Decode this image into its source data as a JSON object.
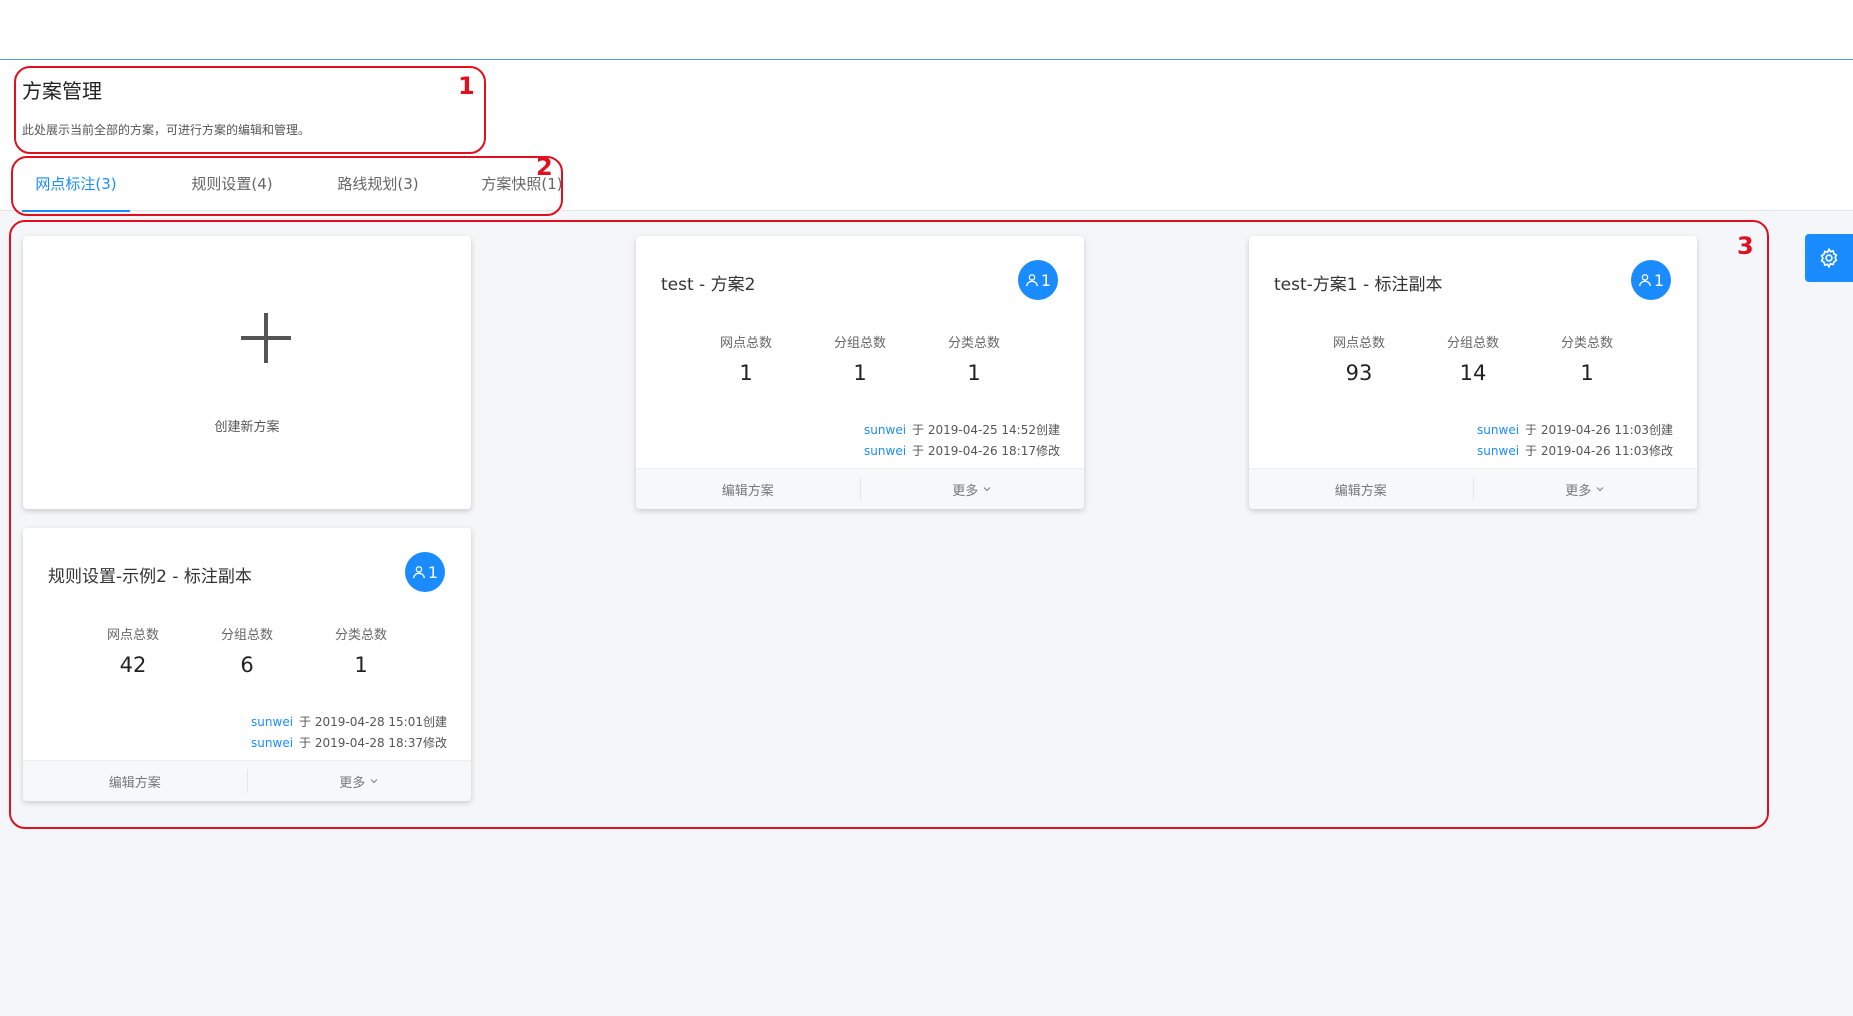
{
  "header": {
    "title": "方案管理",
    "description": "此处展示当前全部的方案，可进行方案的编辑和管理。"
  },
  "tabs": [
    {
      "label": "网点标注(3)",
      "active": true
    },
    {
      "label": "规则设置(4)",
      "active": false
    },
    {
      "label": "路线规划(3)",
      "active": false
    },
    {
      "label": "方案快照(1)",
      "active": false
    }
  ],
  "create_card": {
    "label": "创建新方案"
  },
  "stat_labels": {
    "points": "网点总数",
    "groups": "分组总数",
    "categories": "分类总数"
  },
  "plans": [
    {
      "title": "test - 方案2",
      "users": "1",
      "points": "1",
      "groups": "1",
      "categories": "1",
      "created_by": "sunwei",
      "created_text": "于  2019-04-25 14:52创建",
      "modified_by": "sunwei",
      "modified_text": "于  2019-04-26 18:17修改"
    },
    {
      "title": "test-方案1 - 标注副本",
      "users": "1",
      "points": "93",
      "groups": "14",
      "categories": "1",
      "created_by": "sunwei",
      "created_text": "于  2019-04-26 11:03创建",
      "modified_by": "sunwei",
      "modified_text": "于  2019-04-26 11:03修改"
    },
    {
      "title": "规则设置-示例2 - 标注副本",
      "users": "1",
      "points": "42",
      "groups": "6",
      "categories": "1",
      "created_by": "sunwei",
      "created_text": "于  2019-04-28 15:01创建",
      "modified_by": "sunwei",
      "modified_text": "于  2019-04-28 18:37修改"
    }
  ],
  "footer": {
    "edit_label": "编辑方案",
    "more_label": "更多"
  },
  "annotations": [
    "1",
    "2",
    "3"
  ],
  "colors": {
    "accent": "#1a8cff",
    "annotation": "#e0101e",
    "background": "#f5f6f9"
  },
  "icons": {
    "user": "user-icon",
    "settings": "gear-icon",
    "more": "chevron-down-icon",
    "create": "plus-icon"
  }
}
